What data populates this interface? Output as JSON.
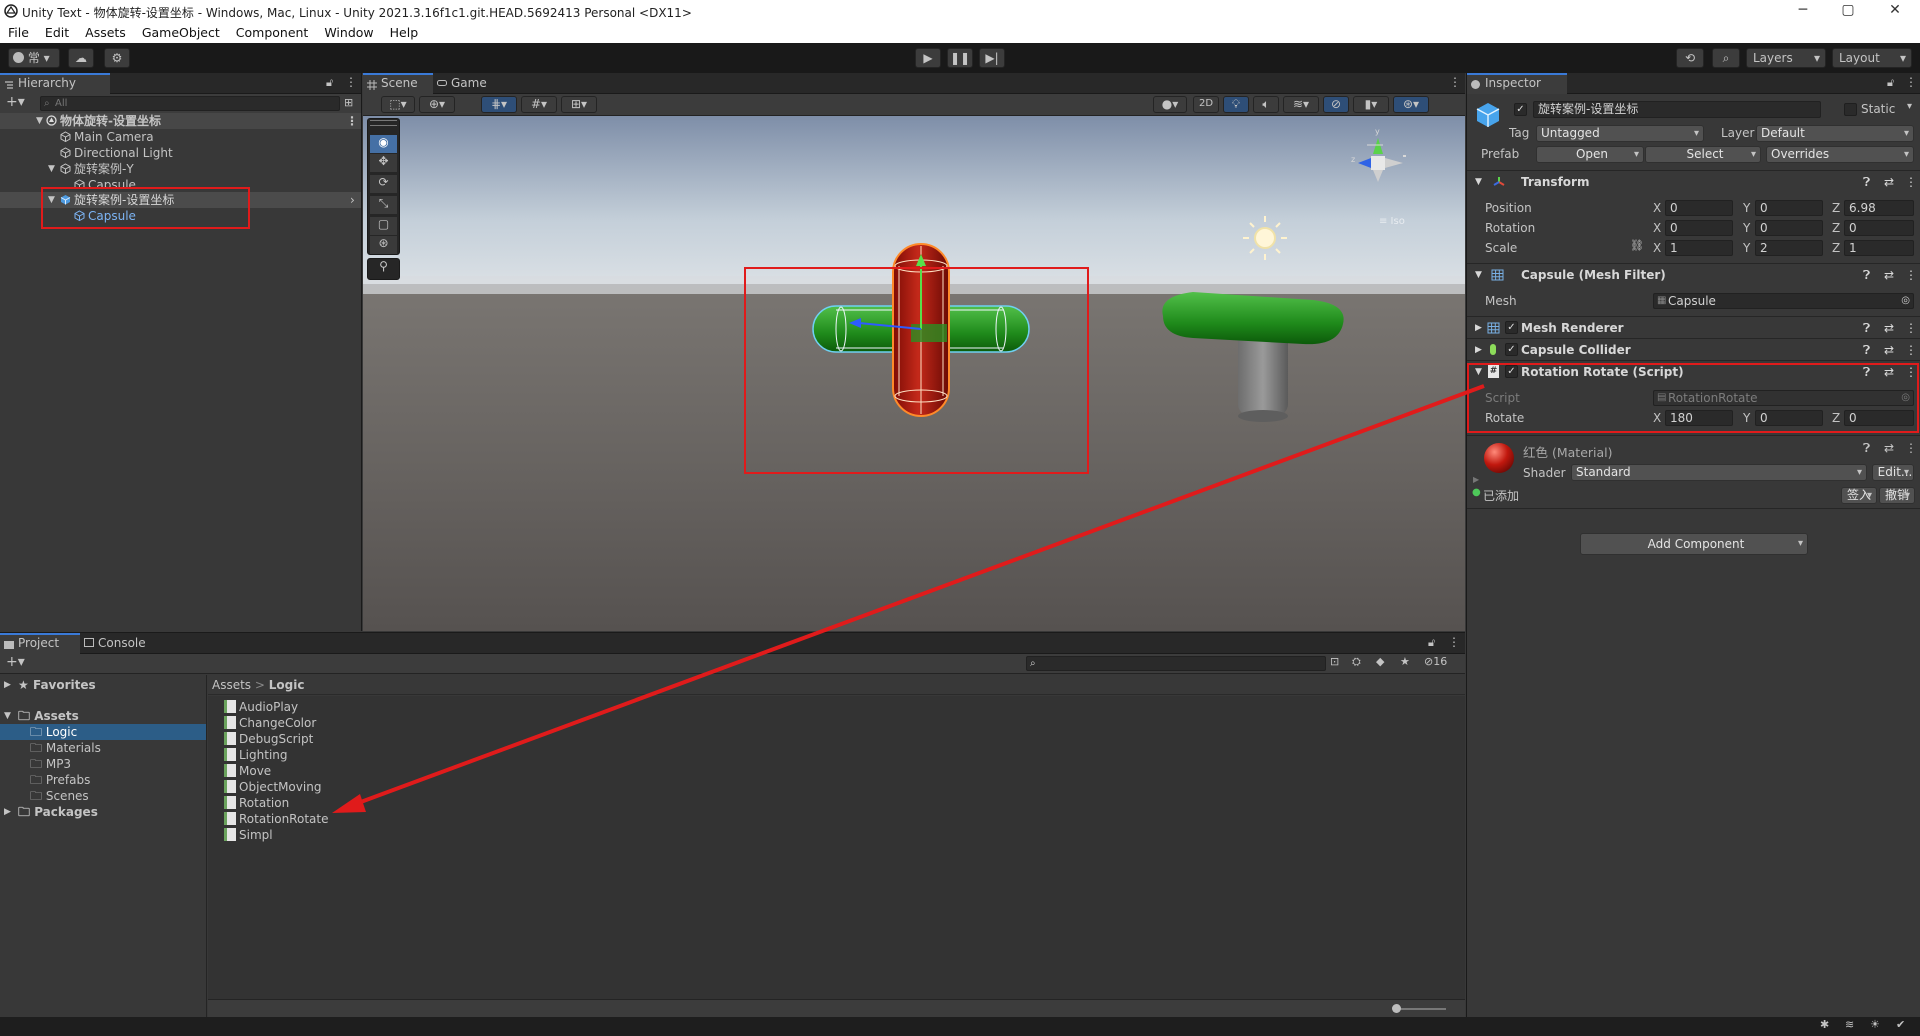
{
  "window": {
    "title": "Unity Text - 物体旋转-设置坐标 - Windows, Mac, Linux - Unity 2021.3.16f1c1.git.HEAD.5692413 Personal <DX11>",
    "min": "─",
    "max": "▢",
    "close": "✕"
  },
  "menu": [
    "File",
    "Edit",
    "Assets",
    "GameObject",
    "Component",
    "Window",
    "Help"
  ],
  "toolbar": {
    "account": "常",
    "layers": "Layers",
    "layout": "Layout"
  },
  "hierarchy": {
    "tab": "Hierarchy",
    "search_placeholder": "All",
    "rows": [
      {
        "label": "物体旋转-设置坐标",
        "kind": "scene"
      },
      {
        "label": "Main Camera",
        "kind": "object"
      },
      {
        "label": "Directional Light",
        "kind": "object"
      },
      {
        "label": "旋转案例-Y",
        "kind": "object"
      },
      {
        "label": "Capsule",
        "kind": "object"
      },
      {
        "label": "旋转案例-设置坐标",
        "kind": "prefab"
      },
      {
        "label": "Capsule",
        "kind": "prefab-child"
      }
    ]
  },
  "scene": {
    "tab_scene": "Scene",
    "tab_game": "Game",
    "mode_2d": "2D",
    "gizmo_label": "≡ Iso"
  },
  "project": {
    "tab_project": "Project",
    "tab_console": "Console",
    "favorites": "Favorites",
    "assets": "Assets",
    "folders": [
      "Logic",
      "Materials",
      "MP3",
      "Prefabs",
      "Scenes"
    ],
    "packages": "Packages",
    "breadcrumb_root": "Assets",
    "breadcrumb_sep": ">",
    "breadcrumb_current": "Logic",
    "count": "16",
    "files": [
      "AudioPlay",
      "ChangeColor",
      "DebugScript",
      "Lighting",
      "Move",
      "ObjectMoving",
      "Rotation",
      "RotationRotate",
      "Simpl"
    ]
  },
  "inspector": {
    "tab": "Inspector",
    "object_name": "旋转案例-设置坐标",
    "static_label": "Static",
    "tag_label": "Tag",
    "tag_value": "Untagged",
    "layer_label": "Layer",
    "layer_value": "Default",
    "prefab_label": "Prefab",
    "prefab_open": "Open",
    "prefab_select": "Select",
    "prefab_overrides": "Overrides",
    "transform": {
      "title": "Transform",
      "position_label": "Position",
      "position": {
        "x": "0",
        "y": "0",
        "z": "6.98"
      },
      "rotation_label": "Rotation",
      "rotation": {
        "x": "0",
        "y": "0",
        "z": "0"
      },
      "scale_label": "Scale",
      "scale": {
        "x": "1",
        "y": "2",
        "z": "1"
      }
    },
    "mesh_filter": {
      "title": "Capsule (Mesh Filter)",
      "mesh_label": "Mesh",
      "mesh_value": "Capsule"
    },
    "mesh_renderer": {
      "title": "Mesh Renderer"
    },
    "capsule_collider": {
      "title": "Capsule Collider"
    },
    "script": {
      "title": "Rotation Rotate (Script)",
      "script_label": "Script",
      "script_value": "RotationRotate",
      "rotate_label": "Rotate",
      "rotate": {
        "x": "180",
        "y": "0",
        "z": "0"
      }
    },
    "material": {
      "title": "红色 (Material)",
      "shader_label": "Shader",
      "shader_value": "Standard",
      "edit": "Edit...",
      "added": "已添加",
      "sign": "签入",
      "revert": "撤销"
    },
    "add_component": "Add Component"
  },
  "colors": {
    "accent": "#3a7ad8",
    "highlight": "#e01b1b",
    "selection": "#2c5d87"
  }
}
